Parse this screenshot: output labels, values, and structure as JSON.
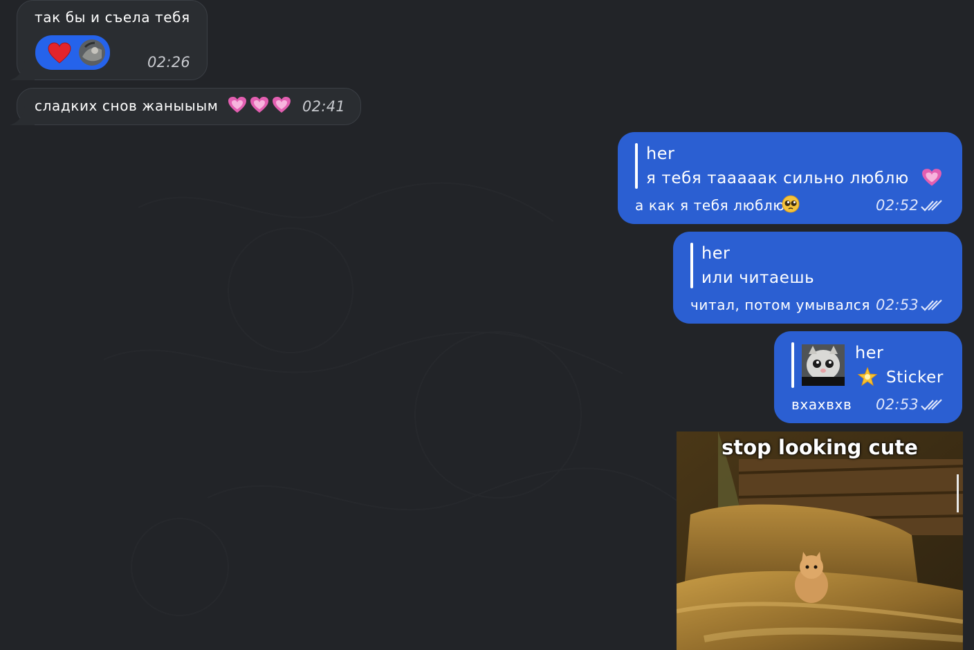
{
  "messages": {
    "m1": {
      "text": "так бы и съела тебя",
      "time": "02:26",
      "reaction": "heart-reaction"
    },
    "m2": {
      "text": "сладких снов жаныыым",
      "time": "02:41"
    },
    "m3": {
      "reply_name": "her",
      "reply_text": "я тебя тааааак сильно люблю",
      "text": "а как я тебя люблю",
      "time": "02:52"
    },
    "m4": {
      "reply_name": "her",
      "reply_text": "или читаешь",
      "text": "читал, потом умывался",
      "time": "02:53"
    },
    "m5": {
      "reply_name": "her",
      "reply_text": "Sticker",
      "text": "вхахвхв",
      "time": "02:53"
    },
    "m6": {
      "caption": "stop looking cute"
    }
  },
  "colors": {
    "background": "#222428",
    "incoming": "#2a2d31",
    "outgoing": "#2b5fd2",
    "reaction_pill": "#2563eb"
  },
  "icons": [
    "heart-reaction-icon",
    "avatar",
    "sparkling-heart-emoji",
    "pleading-face-emoji",
    "star-emoji",
    "double-check-icon"
  ]
}
